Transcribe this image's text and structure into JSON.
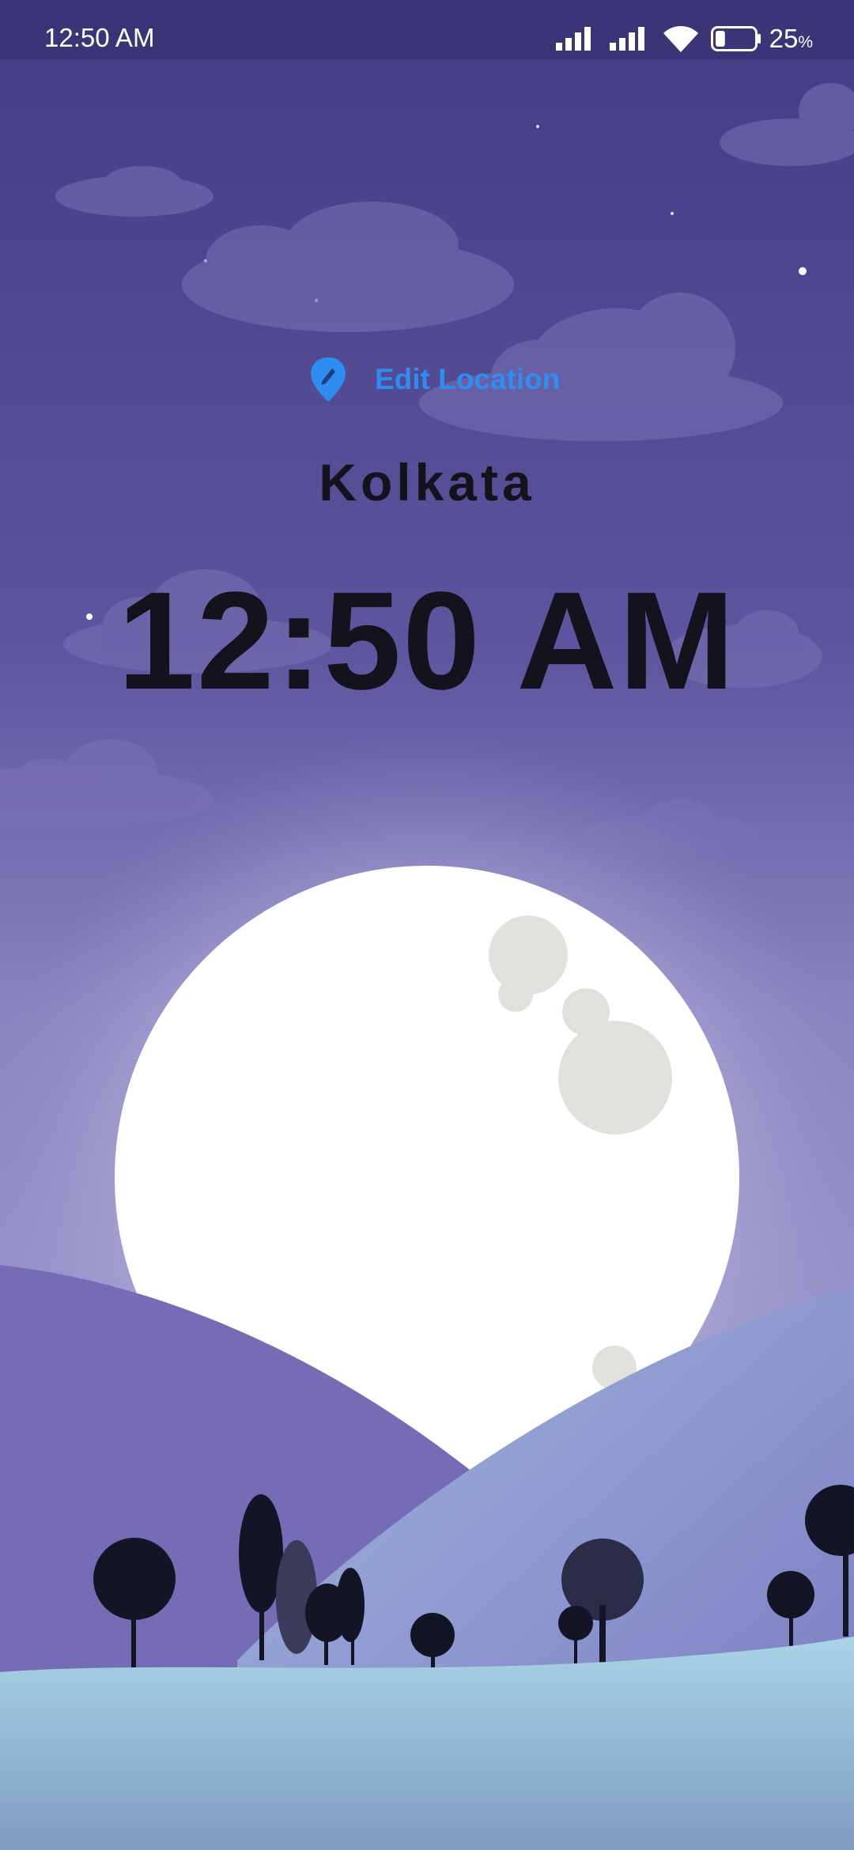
{
  "status_bar": {
    "time": "12:50 AM",
    "battery_percent": "25",
    "battery_unit": "%",
    "battery_level": 0.25,
    "icons": [
      "signal-icon",
      "signal-icon",
      "wifi-icon",
      "battery-icon"
    ]
  },
  "edit_location": {
    "icon": "location-pin-edit-icon",
    "label": "Edit Location",
    "color": "#2f8cf0"
  },
  "location": {
    "city": "Kolkata",
    "time": "12:50 AM"
  },
  "background": {
    "theme": "night",
    "sky_color": "#4a4290",
    "moon_color": "#ffffff"
  }
}
